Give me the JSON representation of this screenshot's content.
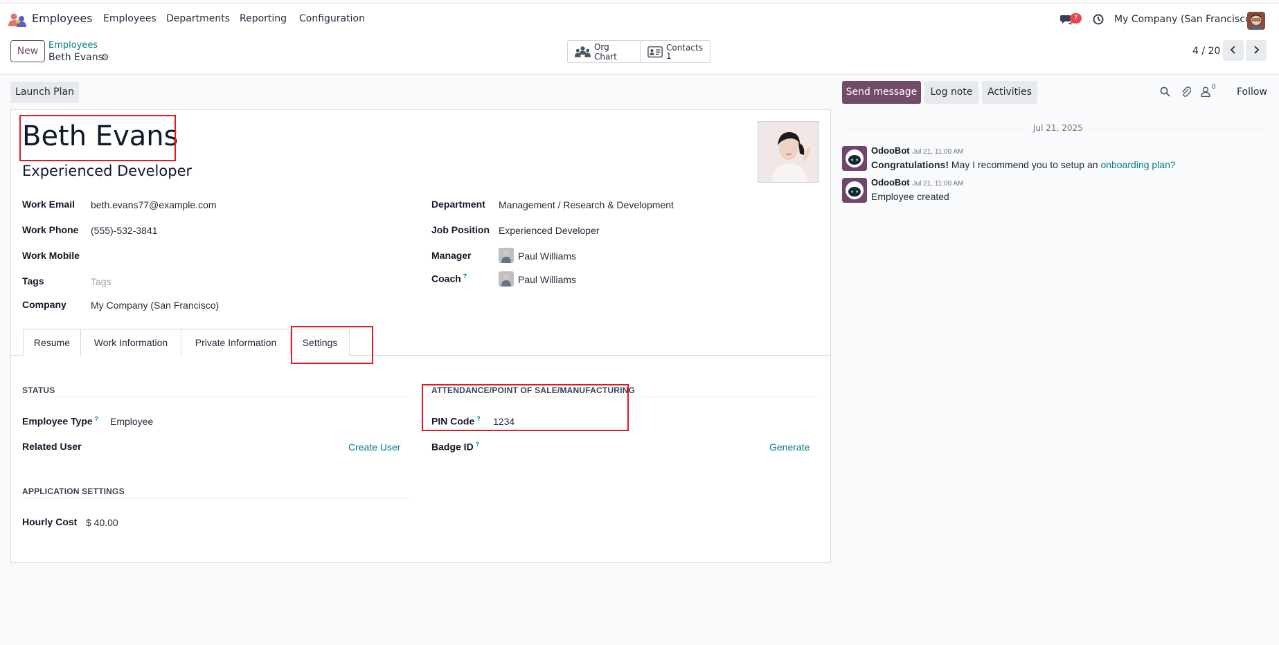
{
  "navbar": {
    "app_name": "Employees",
    "menu": [
      "Employees",
      "Departments",
      "Reporting",
      "Configuration"
    ],
    "message_count": "7",
    "company": "My Company (San Francisco)"
  },
  "control": {
    "new_label": "New",
    "breadcrumb_parent": "Employees",
    "breadcrumb_current": "Beth Evans",
    "org_chart_label": "Org Chart",
    "contacts_label": "Contacts",
    "contacts_count": "1",
    "pager": "4 / 20"
  },
  "form": {
    "launch_plan_label": "Launch Plan",
    "name": "Beth Evans",
    "job_title": "Experienced Developer",
    "left_fields": [
      {
        "label": "Work Email",
        "value": "beth.evans77@example.com"
      },
      {
        "label": "Work Phone",
        "value": "(555)-532-3841"
      },
      {
        "label": "Work Mobile",
        "value": ""
      },
      {
        "label": "Tags",
        "value": "Tags"
      },
      {
        "label": "Company",
        "value": "My Company (San Francisco)"
      }
    ],
    "right_fields": [
      {
        "label": "Department",
        "value": "Management / Research & Development"
      },
      {
        "label": "Job Position",
        "value": "Experienced Developer"
      },
      {
        "label": "Manager",
        "value": "Paul Williams"
      },
      {
        "label": "Coach",
        "value": "Paul Williams"
      }
    ],
    "help_mark": "?",
    "tabs": [
      "Resume",
      "Work Information",
      "Private Information",
      "Settings"
    ],
    "status_section": "STATUS",
    "employee_type_label": "Employee Type",
    "employee_type_value": "Employee",
    "related_user_label": "Related User",
    "create_user_label": "Create User",
    "attendance_section": "ATTENDANCE/POINT OF SALE/MANUFACTURING",
    "pin_label": "PIN Code",
    "pin_value": "1234",
    "badge_label": "Badge ID",
    "generate_label": "Generate",
    "app_settings_section": "APPLICATION SETTINGS",
    "hourly_cost_label": "Hourly Cost",
    "hourly_cost_value": "$ 40.00"
  },
  "chatter": {
    "send_message": "Send message",
    "log_note": "Log note",
    "activities": "Activities",
    "follower_count": "0",
    "follow": "Follow",
    "date_separator": "Jul 21, 2025",
    "messages": [
      {
        "author": "OdooBot",
        "date": "Jul 21, 11:00 AM",
        "bold": "Congratulations!",
        "text": " May I recommend you to setup an ",
        "link": "onboarding plan?"
      },
      {
        "author": "OdooBot",
        "date": "Jul 21, 11:00 AM",
        "text": "Employee created"
      }
    ]
  },
  "colors": {
    "brand": "#714b67",
    "link": "#017e84",
    "highlight": "#e3191f"
  }
}
